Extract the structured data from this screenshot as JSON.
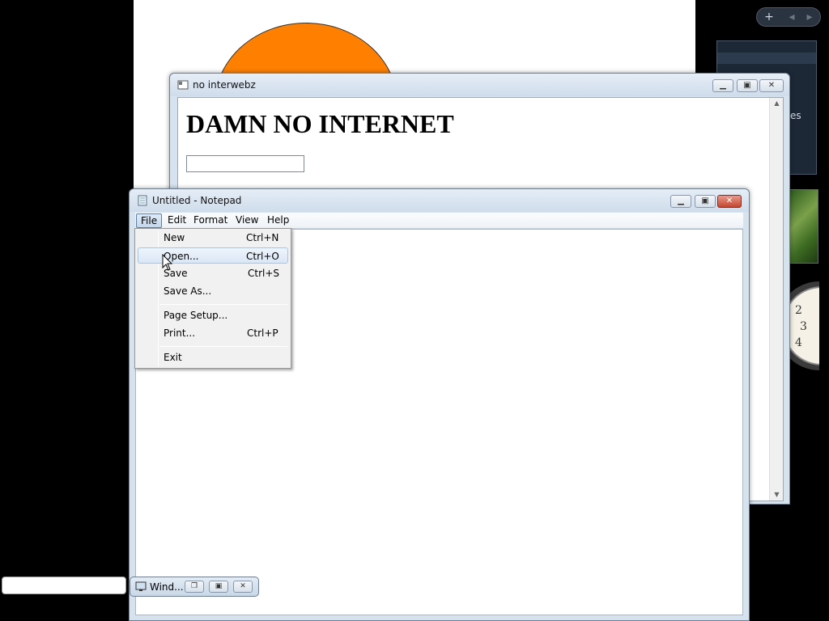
{
  "sidebar": {
    "add_symbol": "+",
    "prev_symbol": "◂",
    "next_symbol": "▸",
    "feed_text": "es",
    "clock_numbers": [
      "2",
      "3",
      "4"
    ]
  },
  "browser_window": {
    "title": "no interwebz",
    "heading": "DAMN NO INTERNET",
    "input_value": ""
  },
  "notepad": {
    "title": "Untitled - Notepad",
    "menu": [
      "File",
      "Edit",
      "Format",
      "View",
      "Help"
    ],
    "content": ""
  },
  "file_menu": {
    "items": [
      {
        "label": "New",
        "shortcut": "Ctrl+N"
      },
      {
        "label": "Open...",
        "shortcut": "Ctrl+O"
      },
      {
        "label": "Save",
        "shortcut": "Ctrl+S"
      },
      {
        "label": "Save As...",
        "shortcut": ""
      },
      {
        "label": "Page Setup...",
        "shortcut": ""
      },
      {
        "label": "Print...",
        "shortcut": "Ctrl+P"
      },
      {
        "label": "Exit",
        "shortcut": ""
      }
    ],
    "highlighted": "Open..."
  },
  "minimized_window": {
    "title": "Wind..."
  },
  "colors": {
    "accent_orange": "#ff8000",
    "desktop": "#000000",
    "menu_highlight": "#dbe7f6",
    "close_button": "#c4472f"
  }
}
